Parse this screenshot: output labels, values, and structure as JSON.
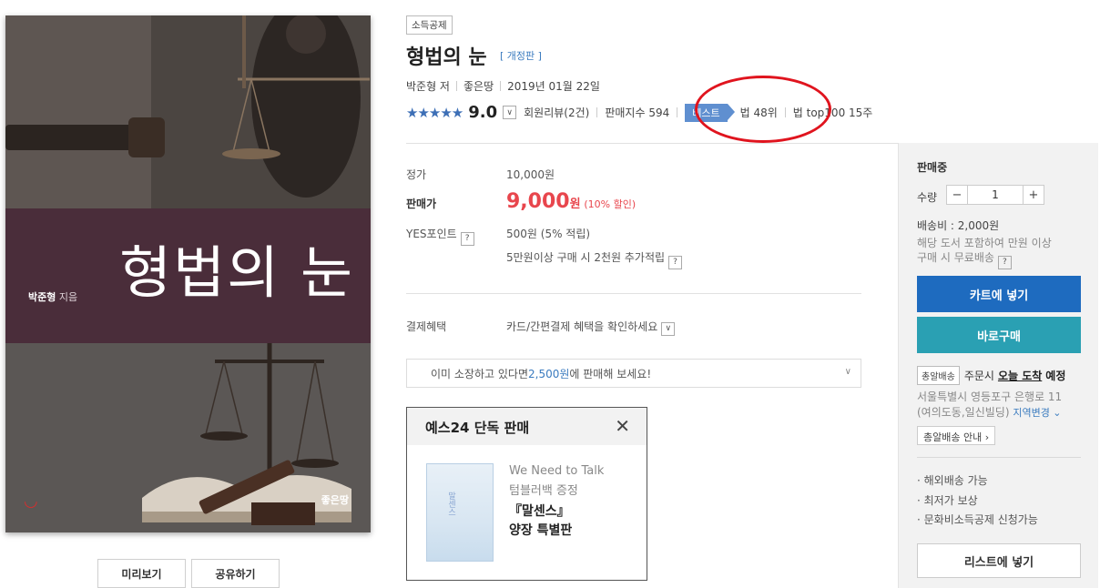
{
  "cover": {
    "title": "형법의 눈",
    "author_name": "박준형",
    "author_suffix": "지음",
    "publisher": "좋은땅"
  },
  "cover_buttons": {
    "preview": "미리보기",
    "share": "공유하기"
  },
  "product": {
    "tag": "소득공제",
    "title": "형법의 눈",
    "edition": "[ 개정판 ]",
    "author": "박준형 저",
    "publisher": "좋은땅",
    "date": "2019년 01월 22일",
    "stars": "★★★★★",
    "score": "9.0",
    "reviews": "회원리뷰(2건)",
    "sales_index": "판매지수 594",
    "best_badge": "베스트",
    "best_rank": "법 48위",
    "top100": "법 top100 15주"
  },
  "price": {
    "list_label": "정가",
    "list_value": "10,000원",
    "sale_label": "판매가",
    "sale_value": "9,000",
    "sale_unit": "원",
    "discount": "(10% 할인)",
    "points_label": "YES포인트",
    "points_value": "500원 (5% 적립)",
    "points_extra": "5만원이상 구매 시 2천원 추가적립",
    "payment_label": "결제혜택",
    "payment_value": "카드/간편결제 혜택을 확인하세요"
  },
  "sell_box": {
    "prefix": "이미 소장하고 있다면 ",
    "amount": "2,500원",
    "suffix": "에 판매해 보세요!"
  },
  "exclusive": {
    "title": "예스24 단독 판매",
    "line1": "We Need to Talk",
    "line2": "텀블러백 증정",
    "line3": "『말센스』",
    "line4": "양장 특별판",
    "thumb_text": "말센스"
  },
  "sidebar": {
    "status": "판매중",
    "qty_label": "수량",
    "qty_value": "1",
    "minus": "−",
    "plus": "+",
    "ship_fee": "배송비 : 2,000원",
    "ship_note1": "해당 도서 포함하여 만원 이상",
    "ship_note2": "구매 시 무료배송",
    "cart": "카트에 넣기",
    "buy": "바로구매",
    "delivery_tag": "총알배송",
    "delivery_pre": "주문시",
    "delivery_today": "오늘 도착",
    "delivery_expect": "예정",
    "addr1": "서울특별시 영등포구 은행로 11",
    "addr2": "(여의도동,일신빌딩)",
    "addr_change": "지역변경",
    "guide": "총알배송 안내",
    "bullets": [
      "· 해외배송 가능",
      "· 최저가 보상",
      "· 문화비소득공제 신청가능"
    ],
    "list_btn": "리스트에 넣기"
  }
}
